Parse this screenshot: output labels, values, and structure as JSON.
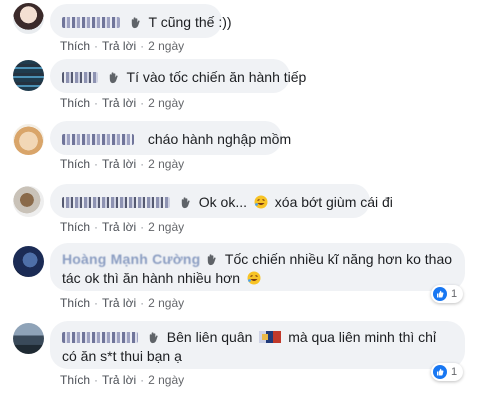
{
  "comments": [
    {
      "text": "T cũng thế :))",
      "actions": {
        "like": "Thích",
        "reply": "Trả lời",
        "time": "2 ngày"
      }
    },
    {
      "text": "Tí vào tốc chiến ăn hành tiếp",
      "actions": {
        "like": "Thích",
        "reply": "Trả lời",
        "time": "2 ngày"
      }
    },
    {
      "text": "cháo hành nghập mồm",
      "actions": {
        "like": "Thích",
        "reply": "Trả lời",
        "time": "2 ngày"
      }
    },
    {
      "text_before": "Ok ok...",
      "text_after": "xóa bớt giùm cái đi",
      "actions": {
        "like": "Thích",
        "reply": "Trả lời",
        "time": "2 ngày"
      }
    },
    {
      "name": "Hoàng Mạnh Cường",
      "text": "Tốc chiến nhiều kĩ năng hơn ko thao tác ok thì ăn hành nhiều hơn",
      "actions": {
        "like": "Thích",
        "reply": "Trả lời",
        "time": "2 ngày"
      },
      "reaction_count": "1"
    },
    {
      "text_before": "Bên liên quân",
      "text_after": "mà qua liên minh thì chỉ có ăn s*t thui bạn ạ",
      "actions": {
        "like": "Thích",
        "reply": "Trả lời",
        "time": "2 ngày"
      },
      "reaction_count": "1"
    }
  ],
  "colors": {
    "bubble": "#f0f2f5",
    "link": "#385898",
    "meta": "#65676b",
    "like": "#1877f2"
  }
}
